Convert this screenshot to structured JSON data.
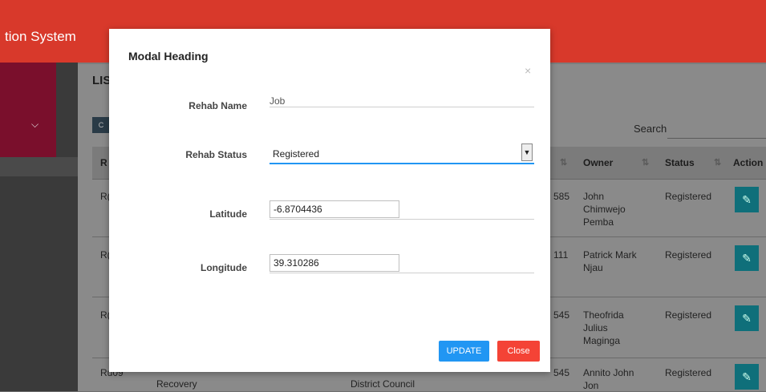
{
  "header": {
    "app_title": "tion System"
  },
  "background": {
    "list_title": "LIS",
    "csv_label": "C",
    "search_label": "Search:",
    "columns": [
      {
        "label": "R"
      },
      {
        "label": "Owner"
      },
      {
        "label": "Status"
      },
      {
        "label": "Action"
      }
    ],
    "sort_icon": "⇅",
    "rows": [
      {
        "id": "R(",
        "phone": "585",
        "owner": "John\nChimwejo\nPemba",
        "status": "Registered"
      },
      {
        "id": "R(",
        "phone": "111",
        "owner": "Patrick Mark\nNjau",
        "status": "Registered"
      },
      {
        "id": "R(",
        "phone": "545",
        "owner": "Theofrida\nJulius\nMaginga",
        "status": "Registered"
      },
      {
        "id": "Ru09",
        "name": "Recovery",
        "council": "District Council",
        "phone": "545",
        "owner": "Annito John\nJon",
        "status": "Registered"
      }
    ]
  },
  "modal": {
    "title": "Modal Heading",
    "close_glyph": "×",
    "fields": {
      "rehab_name": {
        "label": "Rehab Name",
        "value": "Job"
      },
      "rehab_status": {
        "label": "Rehab Status",
        "value": "Registered"
      },
      "latitude": {
        "label": "Latitude",
        "value": "-6.8704436"
      },
      "longitude": {
        "label": "Longitude",
        "value": "39.310286"
      }
    },
    "buttons": {
      "update": "UPDATE",
      "close": "Close"
    }
  },
  "colors": {
    "header": "#d8392b",
    "primary": "#2196f3",
    "danger": "#f44336"
  },
  "icons": {
    "sidebar_toggle": "chevron-down-icon",
    "edit": "pencil-icon",
    "modal_close": "close-icon"
  }
}
